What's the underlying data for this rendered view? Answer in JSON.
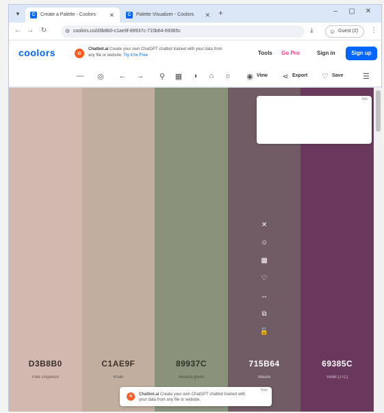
{
  "browser": {
    "tabs": [
      {
        "title": "Create a Palette - Coolors",
        "close": "✕"
      },
      {
        "title": "Palette Visualizer - Coolors",
        "close": "✕"
      }
    ],
    "new_tab": "+",
    "url": "coolors.co/d3b8b0-c1ae9f-89937c-715b64-69385c",
    "profile_label": "Guest (2)"
  },
  "site": {
    "logo": "coolors",
    "promo_title": "Chatbot.ai",
    "promo_text": "Create your own ChatGPT chatbot trained with your data from any file or website.",
    "promo_cta": "Try it for Free",
    "nav": {
      "tools": "Tools",
      "gopro": "Go Pro",
      "signin": "Sign in",
      "signup": "Sign up"
    }
  },
  "toolbar": {
    "view": "View",
    "export": "Export",
    "save": "Save"
  },
  "palette": [
    {
      "hex": "D3B8B0",
      "name": "Pale Dogwood",
      "color": "#d3b8b0",
      "text": "#3a2e2b"
    },
    {
      "hex": "C1AE9F",
      "name": "Khaki",
      "color": "#c1ae9f",
      "text": "#3b342d"
    },
    {
      "hex": "89937C",
      "name": "Reseda green",
      "color": "#89937c",
      "text": "#2f3327"
    },
    {
      "hex": "715B64",
      "name": "Mauve",
      "color": "#715b64",
      "text": "#ffffff"
    },
    {
      "hex": "69385C",
      "name": "Violet (JTC)",
      "color": "#69385c",
      "text": "#ffffff"
    }
  ],
  "ad_tag": "Ads",
  "banner": {
    "title": "Chatbot.ai",
    "text": "Create your own ChatGPT chatbot trained with your data from any file or website.",
    "close": "Hide"
  },
  "icons": [
    "close-icon",
    "contrast-icon",
    "grid-icon",
    "heart-icon",
    "drag-icon",
    "copy-icon",
    "lock-icon"
  ]
}
